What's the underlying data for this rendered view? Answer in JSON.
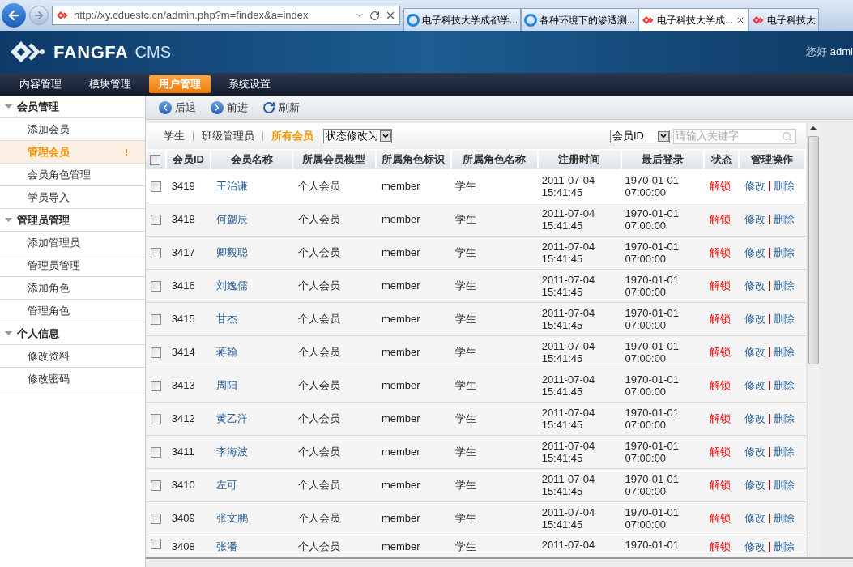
{
  "browser": {
    "address": "http://xy.cduestc.cn/admin.php?m=findex&a=index",
    "tabs": [
      {
        "title": "电子科技大学成都学...",
        "kind": "ie",
        "selected": false
      },
      {
        "title": "各种环境下的渗透测...",
        "kind": "ie",
        "selected": false
      },
      {
        "title": "电子科技大学成...",
        "kind": "site",
        "selected": true
      },
      {
        "title": "电子科技大",
        "kind": "site",
        "selected": false
      }
    ]
  },
  "header": {
    "logo_name": "FANGFA",
    "logo_suffix": "CMS",
    "greeting": "您好",
    "user": "admi"
  },
  "nav": [
    {
      "label": "内容管理",
      "selected": false
    },
    {
      "label": "模块管理",
      "selected": false
    },
    {
      "label": "用户管理",
      "selected": true
    },
    {
      "label": "系统设置",
      "selected": false
    }
  ],
  "sidebar": [
    {
      "title": "会员管理",
      "expanded": true,
      "items": [
        {
          "label": "添加会员",
          "selected": false
        },
        {
          "label": "管理会员",
          "selected": true
        },
        {
          "label": "会员角色管理",
          "selected": false
        },
        {
          "label": "学员导入",
          "selected": false
        }
      ]
    },
    {
      "title": "管理员管理",
      "expanded": true,
      "items": [
        {
          "label": "添加管理员",
          "selected": false
        },
        {
          "label": "管理员管理",
          "selected": false
        },
        {
          "label": "添加角色",
          "selected": false
        },
        {
          "label": "管理角色",
          "selected": false
        }
      ]
    },
    {
      "title": "个人信息",
      "expanded": true,
      "items": [
        {
          "label": "修改资料",
          "selected": false
        },
        {
          "label": "修改密码",
          "selected": false
        }
      ]
    }
  ],
  "toolbar": [
    {
      "label": "后退",
      "kind": "back"
    },
    {
      "label": "前进",
      "kind": "forward"
    },
    {
      "label": "刷新",
      "kind": "refresh"
    }
  ],
  "filters": [
    {
      "label": "学生",
      "selected": false
    },
    {
      "label": "班级管理员",
      "selected": false
    },
    {
      "label": "所有会员",
      "selected": true
    }
  ],
  "status_select": "状态修改为",
  "search": {
    "field": "会员ID",
    "placeholder": "请输入关键字"
  },
  "table": {
    "select_all": {
      "checked": false
    },
    "columns": [
      "会员ID",
      "会员名称",
      "所属会员模型",
      "所属角色标识",
      "所属角色名称",
      "注册时间",
      "最后登录",
      "状态",
      "管理操作"
    ],
    "rows": [
      {
        "checked": false,
        "id": "3419",
        "name": "王治谦",
        "model": "个人会员",
        "role_id": "member",
        "role_name": "学生",
        "registered": [
          "2011-07-04",
          "15:41:45"
        ],
        "last_login": [
          "1970-01-01",
          "07:00:00"
        ],
        "status": "解锁",
        "actions": [
          "修改",
          "删除"
        ]
      },
      {
        "checked": false,
        "id": "3418",
        "name": "何勰辰",
        "model": "个人会员",
        "role_id": "member",
        "role_name": "学生",
        "registered": [
          "2011-07-04",
          "15:41:45"
        ],
        "last_login": [
          "1970-01-01",
          "07:00:00"
        ],
        "status": "解锁",
        "actions": [
          "修改",
          "删除"
        ]
      },
      {
        "checked": false,
        "id": "3417",
        "name": "卿毅聪",
        "model": "个人会员",
        "role_id": "member",
        "role_name": "学生",
        "registered": [
          "2011-07-04",
          "15:41:45"
        ],
        "last_login": [
          "1970-01-01",
          "07:00:00"
        ],
        "status": "解锁",
        "actions": [
          "修改",
          "删除"
        ]
      },
      {
        "checked": false,
        "id": "3416",
        "name": "刘逸儒",
        "model": "个人会员",
        "role_id": "member",
        "role_name": "学生",
        "registered": [
          "2011-07-04",
          "15:41:45"
        ],
        "last_login": [
          "1970-01-01",
          "07:00:00"
        ],
        "status": "解锁",
        "actions": [
          "修改",
          "删除"
        ]
      },
      {
        "checked": false,
        "id": "3415",
        "name": "甘杰",
        "model": "个人会员",
        "role_id": "member",
        "role_name": "学生",
        "registered": [
          "2011-07-04",
          "15:41:45"
        ],
        "last_login": [
          "1970-01-01",
          "07:00:00"
        ],
        "status": "解锁",
        "actions": [
          "修改",
          "删除"
        ]
      },
      {
        "checked": false,
        "id": "3414",
        "name": "蒋翰",
        "model": "个人会员",
        "role_id": "member",
        "role_name": "学生",
        "registered": [
          "2011-07-04",
          "15:41:45"
        ],
        "last_login": [
          "1970-01-01",
          "07:00:00"
        ],
        "status": "解锁",
        "actions": [
          "修改",
          "删除"
        ]
      },
      {
        "checked": false,
        "id": "3413",
        "name": "周阳",
        "model": "个人会员",
        "role_id": "member",
        "role_name": "学生",
        "registered": [
          "2011-07-04",
          "15:41:45"
        ],
        "last_login": [
          "1970-01-01",
          "07:00:00"
        ],
        "status": "解锁",
        "actions": [
          "修改",
          "删除"
        ]
      },
      {
        "checked": false,
        "id": "3412",
        "name": "黄乙洋",
        "model": "个人会员",
        "role_id": "member",
        "role_name": "学生",
        "registered": [
          "2011-07-04",
          "15:41:45"
        ],
        "last_login": [
          "1970-01-01",
          "07:00:00"
        ],
        "status": "解锁",
        "actions": [
          "修改",
          "删除"
        ]
      },
      {
        "checked": false,
        "id": "3411",
        "name": "李海波",
        "model": "个人会员",
        "role_id": "member",
        "role_name": "学生",
        "registered": [
          "2011-07-04",
          "15:41:45"
        ],
        "last_login": [
          "1970-01-01",
          "07:00:00"
        ],
        "status": "解锁",
        "actions": [
          "修改",
          "删除"
        ]
      },
      {
        "checked": false,
        "id": "3410",
        "name": "左可",
        "model": "个人会员",
        "role_id": "member",
        "role_name": "学生",
        "registered": [
          "2011-07-04",
          "15:41:45"
        ],
        "last_login": [
          "1970-01-01",
          "07:00:00"
        ],
        "status": "解锁",
        "actions": [
          "修改",
          "删除"
        ]
      },
      {
        "checked": false,
        "id": "3409",
        "name": "张文鹏",
        "model": "个人会员",
        "role_id": "member",
        "role_name": "学生",
        "registered": [
          "2011-07-04",
          "15:41:45"
        ],
        "last_login": [
          "1970-01-01",
          "07:00:00"
        ],
        "status": "解锁",
        "actions": [
          "修改",
          "删除"
        ]
      },
      {
        "checked": false,
        "id": "3408",
        "name": "张潘",
        "model": "个人会员",
        "role_id": "member",
        "role_name": "学生",
        "registered": [
          "2011-07-04"
        ],
        "last_login": [
          "1970-01-01"
        ],
        "status": "解锁",
        "actions": [
          "修改",
          "删除"
        ]
      }
    ]
  }
}
